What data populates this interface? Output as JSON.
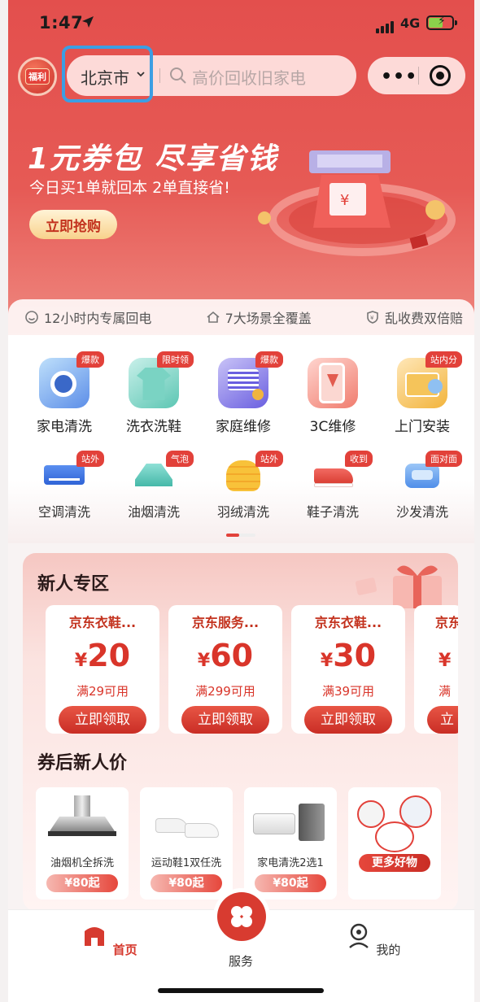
{
  "status_bar": {
    "time": "1:47",
    "network": "4G"
  },
  "top_bar": {
    "welfare_label": "福利",
    "city": "北京市",
    "search_placeholder": "高价回收旧家电",
    "menu_dots": "•••"
  },
  "banner": {
    "title": "1元券包 尽享省钱",
    "subtitle": "今日买1单就回本  2单直接省!",
    "button": "立即抢购"
  },
  "features": [
    {
      "icon": "smile-icon",
      "text": "12小时内专属回电"
    },
    {
      "icon": "home-icon",
      "text": "7大场景全覆盖"
    },
    {
      "icon": "shield-icon",
      "text": "乱收费双倍赔"
    }
  ],
  "services_row1": [
    {
      "label": "家电清洗",
      "tag": "爆款",
      "icon": "washer-icon"
    },
    {
      "label": "洗衣洗鞋",
      "tag": "限时领",
      "icon": "tshirt-icon"
    },
    {
      "label": "家庭维修",
      "tag": "爆款",
      "icon": "repair-icon"
    },
    {
      "label": "3C维修",
      "tag": "",
      "icon": "phone-repair-icon"
    },
    {
      "label": "上门安装",
      "tag": "站内分",
      "icon": "install-icon"
    }
  ],
  "services_row2": [
    {
      "label": "空调清洗",
      "tag": "站外",
      "icon": "air-conditioner-icon"
    },
    {
      "label": "油烟清洗",
      "tag": "气泡",
      "icon": "range-hood-icon"
    },
    {
      "label": "羽绒清洗",
      "tag": "站外",
      "icon": "down-jacket-icon"
    },
    {
      "label": "鞋子清洗",
      "tag": "收到",
      "icon": "shoe-icon"
    },
    {
      "label": "沙发清洗",
      "tag": "面对面",
      "icon": "sofa-icon"
    }
  ],
  "new_user": {
    "title": "新人专区",
    "coupons": [
      {
        "title": "京东衣鞋...",
        "currency": "¥",
        "amount": "20",
        "condition": "满29可用",
        "button": "立即领取"
      },
      {
        "title": "京东服务...",
        "currency": "¥",
        "amount": "60",
        "condition": "满299可用",
        "button": "立即领取"
      },
      {
        "title": "京东衣鞋...",
        "currency": "¥",
        "amount": "30",
        "condition": "满39可用",
        "button": "立即领取"
      },
      {
        "title": "京东",
        "currency": "¥",
        "amount": "",
        "condition": "满",
        "button": "立"
      }
    ],
    "section2_title": "券后新人价",
    "products": [
      {
        "name": "油烟机全拆洗",
        "price": "¥80起"
      },
      {
        "name": "运动鞋1双任洗",
        "price": "¥80起"
      },
      {
        "name": "家电清洗2选1",
        "price": "¥80起"
      },
      {
        "name": "",
        "price": "更多好物"
      }
    ]
  },
  "tab_bar": [
    {
      "label": "首页",
      "active": true
    },
    {
      "label": "服务",
      "active": false
    },
    {
      "label": "我的",
      "active": false
    }
  ],
  "colors": {
    "brand_red": "#e2413a",
    "hero_red": "#e34f4d",
    "highlight_blue": "#3c9ee3"
  }
}
